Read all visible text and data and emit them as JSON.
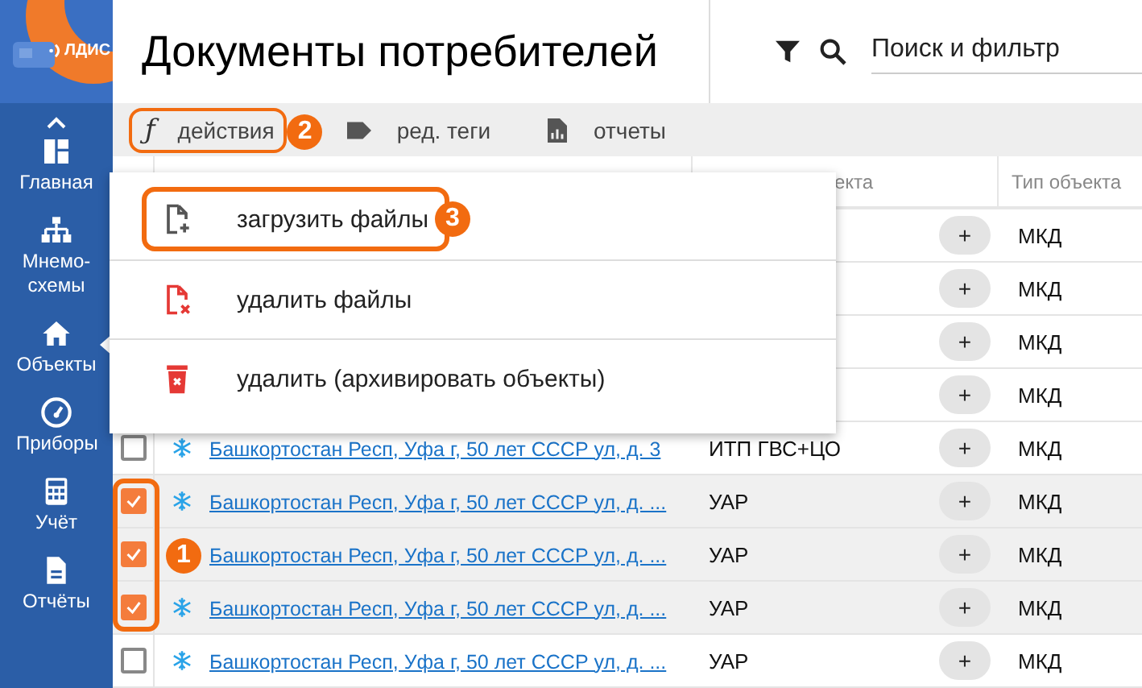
{
  "logo": {
    "text": "ЛДИС"
  },
  "sidebar": {
    "items": [
      {
        "label": "Главная",
        "selected": false
      },
      {
        "label": "Мнемо-схемы",
        "selected": false
      },
      {
        "label": "Объекты",
        "selected": true
      },
      {
        "label": "Приборы",
        "selected": false
      },
      {
        "label": "Учёт",
        "selected": false
      },
      {
        "label": "Отчёты",
        "selected": false
      }
    ]
  },
  "header": {
    "title": "Документы потребителей",
    "search": {
      "placeholder": "Поиск и фильтр"
    }
  },
  "toolbar": {
    "items": [
      {
        "label": "действия",
        "symbol": "ƒ",
        "callout": "2"
      },
      {
        "label": "ред. теги"
      },
      {
        "label": "отчеты"
      }
    ]
  },
  "table": {
    "columns": [
      {
        "label": "екта"
      },
      {
        "label": "Тип объекта"
      }
    ],
    "selection_callout": "1",
    "rows": [
      {
        "type": "МКД",
        "button": "+"
      },
      {
        "type": "МКД",
        "button": "+"
      },
      {
        "type": "МКД",
        "button": "+"
      },
      {
        "type": "МКД",
        "button": "+"
      },
      {
        "checked": false,
        "address": "Башкортостан Респ, Уфа г, 50 лет СССР ул, д. 3",
        "system": "ИТП ГВС+ЦО",
        "type": "МКД",
        "button": "+"
      },
      {
        "checked": true,
        "address": "Башкортостан Респ, Уфа г, 50 лет СССР ул, д. ...",
        "system": "УАР",
        "type": "МКД",
        "button": "+"
      },
      {
        "checked": true,
        "address": "Башкортостан Респ, Уфа г, 50 лет СССР ул, д. ...",
        "system": "УАР",
        "type": "МКД",
        "button": "+"
      },
      {
        "checked": true,
        "address": "Башкортостан Респ, Уфа г, 50 лет СССР ул, д. ...",
        "system": "УАР",
        "type": "МКД",
        "button": "+"
      },
      {
        "checked": false,
        "address": "Башкортостан Респ, Уфа г, 50 лет СССР ул, д. ...",
        "system": "УАР",
        "type": "МКД",
        "button": "+"
      }
    ]
  },
  "actions_menu": {
    "items": [
      {
        "label": "загрузить файлы",
        "callout": "3"
      },
      {
        "label": "удалить файлы"
      },
      {
        "label": "удалить (архивировать объекты)"
      }
    ]
  }
}
